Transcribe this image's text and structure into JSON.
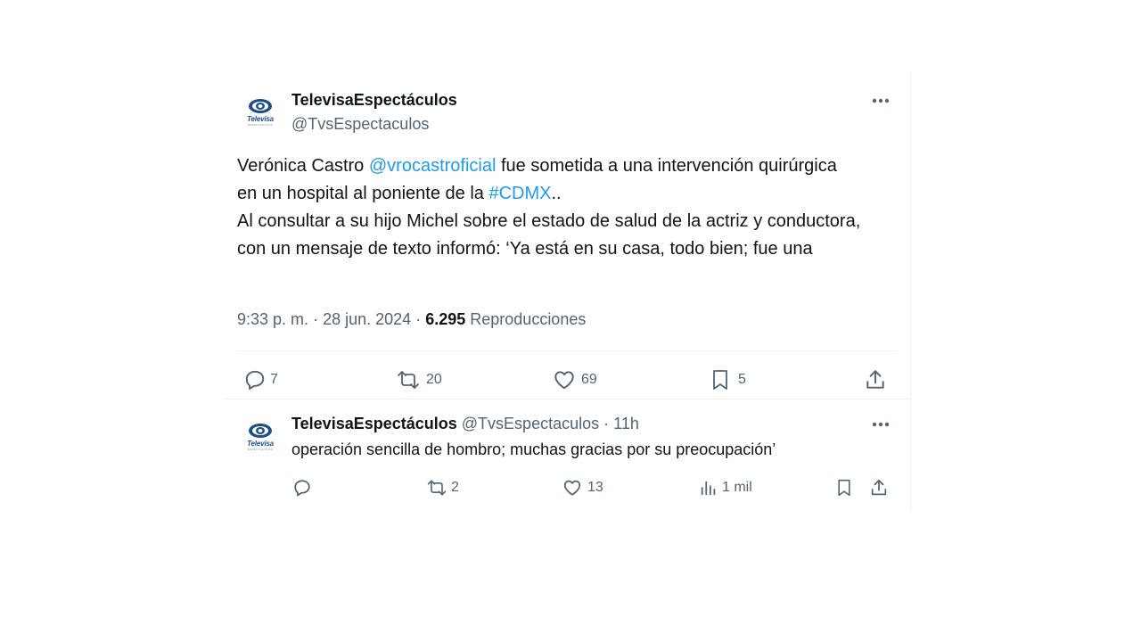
{
  "tweet": {
    "author_name": "TelevisaEspectáculos",
    "author_handle": "@TvsEspectaculos",
    "avatar_label": "Televisa",
    "avatar_sublabel": "ESPECTÁCULOS",
    "text": {
      "part1": "Verónica Castro ",
      "mention": "@vrocastroficial",
      "part2": " fue sometida a una intervención quirúrgica en un hospital al poniente de la ",
      "hashtag": "#CDMX",
      "part3": "..",
      "line2": "Al consultar a su hijo Michel sobre el estado de salud de la actriz y conductora, con un mensaje de texto informó: ‘Ya está en su casa, todo bien; fue una"
    },
    "time": "9:33 p. m.",
    "date": "28 jun. 2024",
    "views_count": "6.295",
    "views_label": "Reproducciones",
    "actions": {
      "replies": "7",
      "retweets": "20",
      "likes": "69",
      "bookmarks": "5"
    }
  },
  "reply": {
    "author_name": "TelevisaEspectáculos",
    "author_handle": "@TvsEspectaculos",
    "time_ago": "11h",
    "avatar_label": "Televisa",
    "avatar_sublabel": "ESPECTÁCULOS",
    "text": "operación sencilla de hombro; muchas gracias por su preocupación’",
    "actions": {
      "replies": "",
      "retweets": "2",
      "likes": "13",
      "views": "1 mil"
    }
  },
  "separator": "·",
  "colors": {
    "link": "#1d9bf0",
    "secondary_text": "#536471",
    "primary_text": "#0f1419",
    "brand_blue": "#1d4e89"
  },
  "icons": [
    "televisa-logo",
    "more-icon",
    "reply-icon",
    "retweet-icon",
    "like-icon",
    "bookmark-icon",
    "share-icon",
    "views-icon"
  ]
}
